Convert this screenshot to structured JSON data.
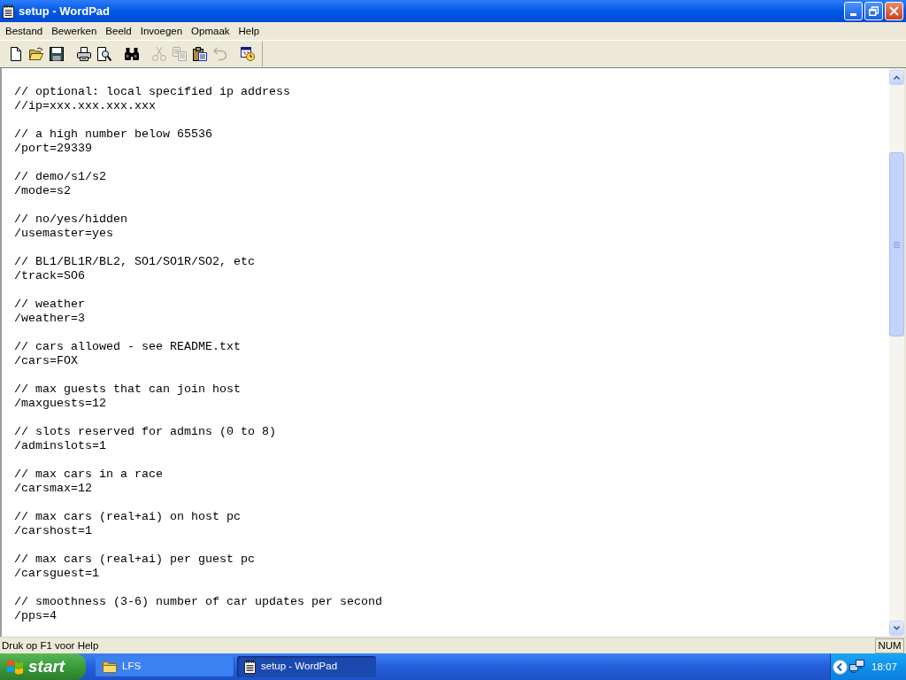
{
  "window": {
    "title": "setup - WordPad"
  },
  "menu": [
    "Bestand",
    "Bewerken",
    "Beeld",
    "Invoegen",
    "Opmaak",
    "Help"
  ],
  "toolbar": {
    "groups": [
      [
        {
          "kind": "new",
          "disabled": false
        },
        {
          "kind": "open",
          "disabled": false
        },
        {
          "kind": "save",
          "disabled": false
        }
      ],
      [
        {
          "kind": "print",
          "disabled": false
        },
        {
          "kind": "preview",
          "disabled": false
        }
      ],
      [
        {
          "kind": "find",
          "disabled": false
        }
      ],
      [
        {
          "kind": "cut",
          "disabled": true
        },
        {
          "kind": "copy",
          "disabled": true
        },
        {
          "kind": "paste",
          "disabled": false
        },
        {
          "kind": "undo",
          "disabled": true
        }
      ],
      [
        {
          "kind": "datetime",
          "disabled": false
        }
      ]
    ]
  },
  "document": {
    "paragraphs": [
      [
        "// optional: local specified ip address",
        "//ip=xxx.xxx.xxx.xxx"
      ],
      [
        "// a high number below 65536",
        "/port=29339"
      ],
      [
        "// demo/s1/s2",
        "/mode=s2"
      ],
      [
        "// no/yes/hidden",
        "/usemaster=yes"
      ],
      [
        "// BL1/BL1R/BL2, SO1/SO1R/SO2, etc",
        "/track=SO6"
      ],
      [
        "// weather",
        "/weather=3"
      ],
      [
        "// cars allowed - see README.txt",
        "/cars=FOX"
      ],
      [
        "// max guests that can join host",
        "/maxguests=12"
      ],
      [
        "// slots reserved for admins (0 to 8)",
        "/adminslots=1"
      ],
      [
        "// max cars in a race",
        "/carsmax=12"
      ],
      [
        "// max cars (real+ai) on host pc",
        "/carshost=1"
      ],
      [
        "// max cars (real+ai) per guest pc",
        "/carsguest=1"
      ],
      [
        "// smoothness (3-6) number of car updates per second",
        "/pps=4"
      ]
    ]
  },
  "status_bar": {
    "help_text": "Druk op F1 voor Help",
    "indicator": "NUM"
  },
  "taskbar": {
    "start_label": "start",
    "tasks": [
      {
        "kind": "folder",
        "label": "LFS",
        "selected": false
      },
      {
        "kind": "document",
        "label": "setup - WordPad",
        "selected": true
      }
    ],
    "clock": "18:07"
  }
}
